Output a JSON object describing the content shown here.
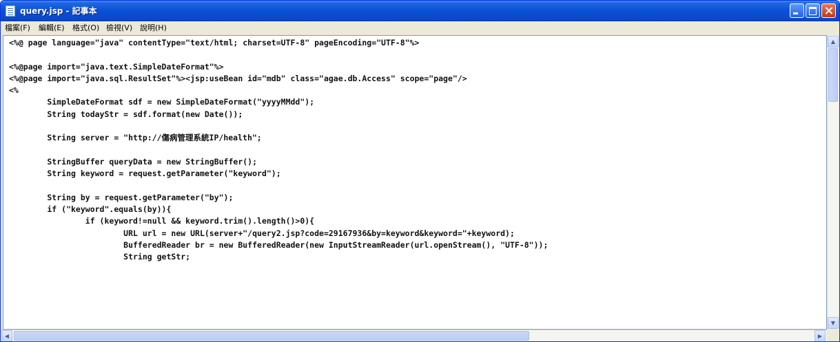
{
  "window": {
    "title": "query.jsp - 記事本",
    "icon": "notepad-icon"
  },
  "menu": {
    "items": [
      "檔案(F)",
      "編輯(E)",
      "格式(O)",
      "檢視(V)",
      "說明(H)"
    ]
  },
  "editor": {
    "lines": [
      "<%@ page language=\"java\" contentType=\"text/html; charset=UTF-8\" pageEncoding=\"UTF-8\"%>",
      "",
      "<%@page import=\"java.text.SimpleDateFormat\"%>",
      "<%@page import=\"java.sql.ResultSet\"%><jsp:useBean id=\"mdb\" class=\"agae.db.Access\" scope=\"page\"/>",
      "<%",
      "        SimpleDateFormat sdf = new SimpleDateFormat(\"yyyyMMdd\");",
      "        String todayStr = sdf.format(new Date());",
      "",
      "        String server = \"http://傷病管理系統IP/health\";",
      "",
      "        StringBuffer queryData = new StringBuffer();",
      "        String keyword = request.getParameter(\"keyword\");",
      "",
      "        String by = request.getParameter(\"by\");",
      "        if (\"keyword\".equals(by)){",
      "                if (keyword!=null && keyword.trim().length()>0){",
      "                        URL url = new URL(server+\"/query2.jsp?code=29167936&by=keyword&keyword=\"+keyword);",
      "                        BufferedReader br = new BufferedReader(new InputStreamReader(url.openStream(), \"UTF-8\"));",
      "                        String getStr;"
    ]
  },
  "colors": {
    "titlebar": "#0a4fd6",
    "close_button": "#c13818"
  }
}
